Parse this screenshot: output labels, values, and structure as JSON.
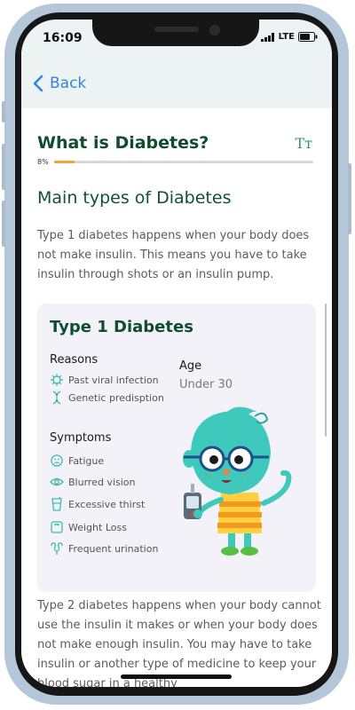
{
  "status_bar": {
    "time": "16:09",
    "network": "LTE"
  },
  "nav": {
    "back_label": "Back"
  },
  "header": {
    "title": "What is Diabetes?",
    "font_toggle": "Tт",
    "progress_label": "8%",
    "progress_fraction": 0.08
  },
  "section": {
    "heading": "Main types of Diabetes",
    "intro": "Type 1 diabetes happens when your body does not make insulin. This means you have to take insulin through shots or an insulin pump."
  },
  "card": {
    "title": "Type 1 Diabetes",
    "reasons_label": "Reasons",
    "reasons": [
      {
        "icon": "virus-icon",
        "label": "Past viral infection"
      },
      {
        "icon": "dna-icon",
        "label": "Genetic predisption"
      }
    ],
    "age_label": "Age",
    "age_value": "Under 30",
    "symptoms_label": "Symptoms",
    "symptoms": [
      {
        "icon": "sad-face-icon",
        "label": "Fatigue"
      },
      {
        "icon": "eye-icon",
        "label": "Blurred vision"
      },
      {
        "icon": "glass-icon",
        "label": "Excessive thirst"
      },
      {
        "icon": "scale-icon",
        "label": "Weight Loss"
      },
      {
        "icon": "kidney-icon",
        "label": "Frequent urination"
      }
    ]
  },
  "paragraph2": "Type 2 diabetes happens when your body cannot use the insulin it makes or when your body does not make enough insulin. You may have to take insulin or another type of medicine to keep your blood sugar in a healthy",
  "colors": {
    "accent_green": "#0f4d2d",
    "link_blue": "#2e86de",
    "progress": "#f2a531",
    "icon_teal": "#3fb9b0"
  }
}
